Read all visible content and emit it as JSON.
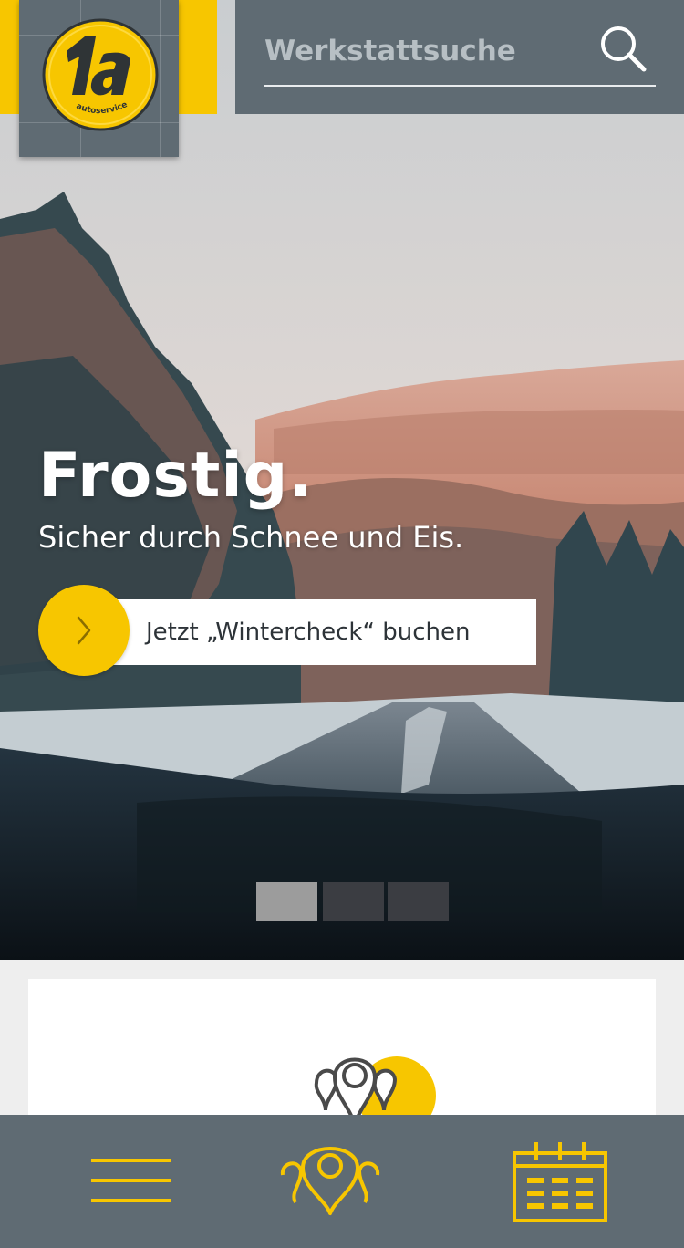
{
  "header": {
    "logo": {
      "text": "1a",
      "subtext": "autoservice",
      "colors": {
        "yellow": "#f7c600",
        "panel": "#5f6b73"
      }
    },
    "search": {
      "placeholder": "Werkstattsuche",
      "icon": "search-icon"
    }
  },
  "hero": {
    "headline": "Frostig.",
    "subline": "Sicher durch Schnee und Eis.",
    "cta_label": "Jetzt „Wintercheck“ buchen",
    "cta_icon": "chevron-right-icon",
    "slides": [
      {
        "label": "Slide 1",
        "active": true
      },
      {
        "label": "Slide 2",
        "active": false
      },
      {
        "label": "Slide 3",
        "active": false
      }
    ]
  },
  "card": {
    "icon": "locations-icon"
  },
  "bottom_nav": {
    "items": [
      {
        "icon": "menu-icon",
        "label": "Menü"
      },
      {
        "icon": "locations-icon",
        "label": "Werkstätten"
      },
      {
        "icon": "calendar-icon",
        "label": "Termin"
      }
    ]
  },
  "colors": {
    "accent": "#f7c600",
    "panel": "#5f6b73",
    "background": "#eeeeee"
  }
}
